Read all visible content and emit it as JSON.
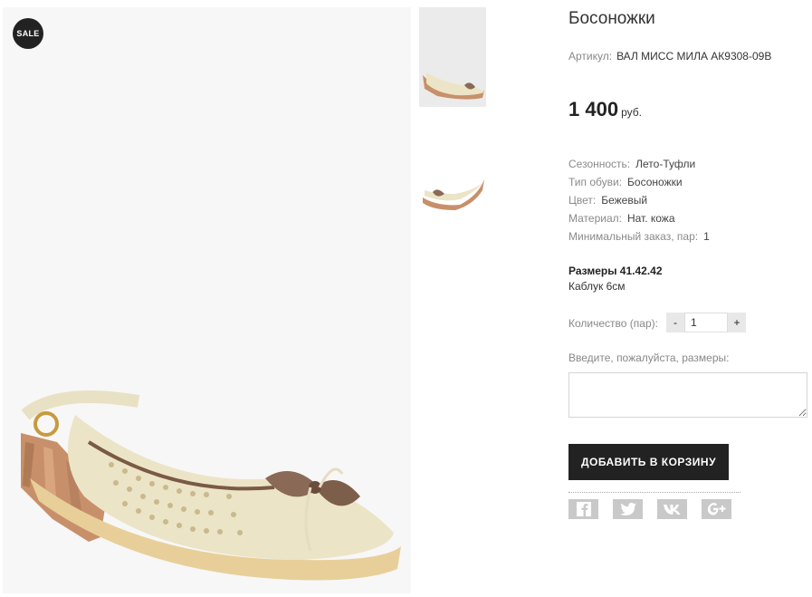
{
  "badge": {
    "label": "SALE"
  },
  "product": {
    "title": "Босоножки",
    "sku_label": "Артикул:",
    "sku_value": "ВАЛ МИСС МИЛА АК9308-09В",
    "price": "1 400",
    "currency": "руб."
  },
  "properties": [
    {
      "label": "Сезонность:",
      "value": "Лето-Туфли"
    },
    {
      "label": "Тип обуви:",
      "value": "Босоножки"
    },
    {
      "label": "Цвет:",
      "value": "Бежевый"
    },
    {
      "label": "Материал:",
      "value": "Нат. кожа"
    },
    {
      "label": "Минимальный заказ, пар:",
      "value": "1"
    }
  ],
  "sizes": {
    "line1": "Размеры 41.42.42",
    "line2": "Каблук 6см"
  },
  "quantity": {
    "label": "Количество (пар):",
    "minus": "-",
    "value": "1",
    "plus": "+"
  },
  "size_input": {
    "label": "Введите, пожалуйста, размеры:",
    "value": ""
  },
  "cart": {
    "button_label": "ДОБАВИТЬ В КОРЗИНУ"
  },
  "social": [
    {
      "name": "facebook-icon",
      "glyph": "f"
    },
    {
      "name": "twitter-icon",
      "glyph": "t"
    },
    {
      "name": "vk-icon",
      "glyph": "vk"
    },
    {
      "name": "google-plus-icon",
      "glyph": "g+"
    }
  ],
  "colors": {
    "accent": "#222222",
    "social_bg": "#c9c9c9",
    "image_bg": "#f7f7f7"
  }
}
